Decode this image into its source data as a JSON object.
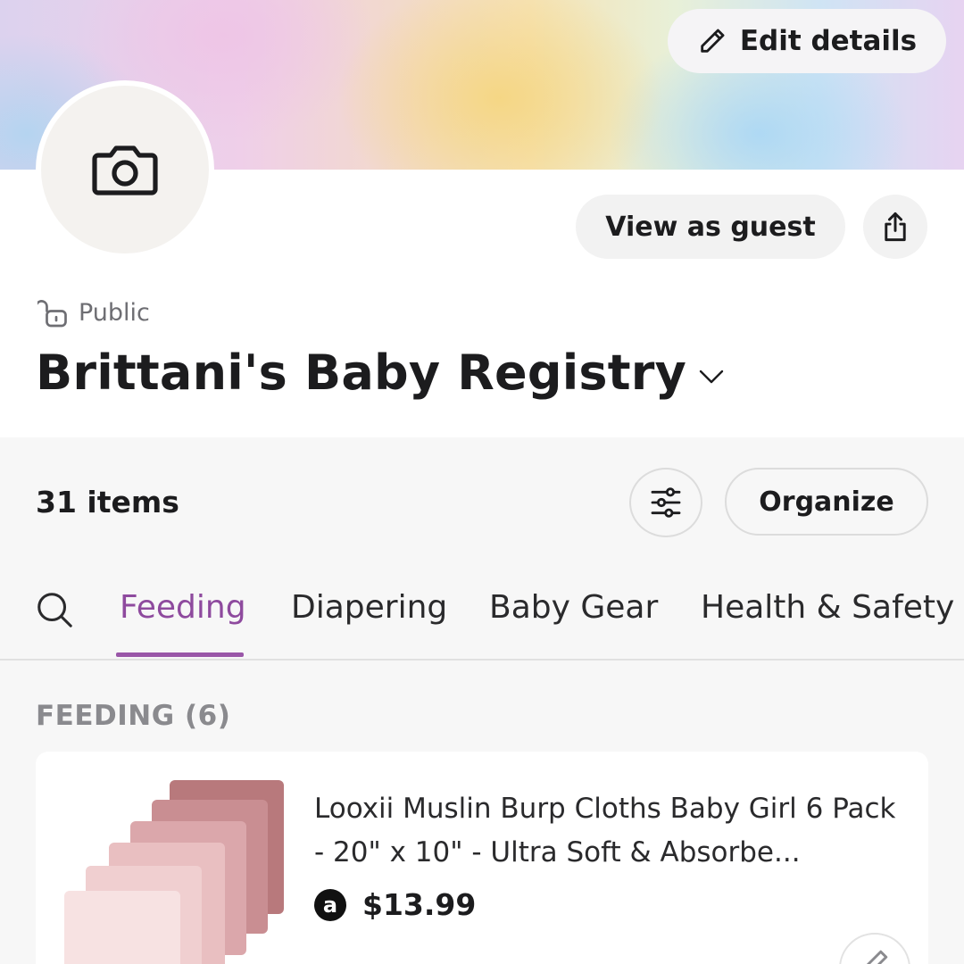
{
  "header": {
    "edit_label": "Edit details",
    "view_guest_label": "View as guest"
  },
  "registry": {
    "visibility": "Public",
    "title": "Brittani's Baby Registry"
  },
  "list": {
    "count_label": "31 items",
    "organize_label": "Organize",
    "tabs": [
      {
        "label": "Feeding",
        "active": true
      },
      {
        "label": "Diapering",
        "active": false
      },
      {
        "label": "Baby Gear",
        "active": false
      },
      {
        "label": "Health & Safety",
        "active": false
      }
    ],
    "section_label": "FEEDING (6)",
    "items": [
      {
        "name": "Looxii Muslin Burp Cloths Baby Girl 6 Pack - 20\" x 10\" - Ultra Soft & Absorbe...",
        "store_logo": "a",
        "price": "$13.99"
      }
    ]
  },
  "icons": {
    "edit": "pencil-icon",
    "share": "share-icon",
    "avatar": "camera-icon",
    "visibility": "unlock-icon",
    "title_menu": "chevron-down-icon",
    "filter": "sliders-icon",
    "search": "search-icon",
    "item_edit": "pencil-icon"
  },
  "colors": {
    "accent": "#8e4a9e",
    "tab_underline": "#9a57a8",
    "section_bg": "#f7f7f7"
  }
}
